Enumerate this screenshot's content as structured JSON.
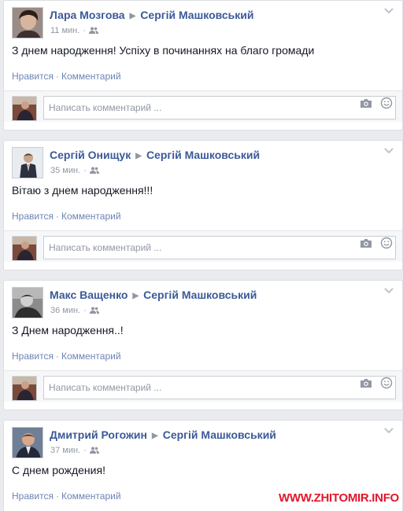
{
  "posts": [
    {
      "author": "Лара Мозгова",
      "target": "Сергій Машковський",
      "time": "11 мин.",
      "text": "З днем народження! Успіху в починаннях на благо громади",
      "like_label": "Нравится",
      "comment_label": "Комментарий",
      "comment_placeholder": "Написать комментарий ..."
    },
    {
      "author": "Сергій Онищук",
      "target": "Сергій Машковський",
      "time": "35 мин.",
      "text": "Вітаю з днем народження!!!",
      "like_label": "Нравится",
      "comment_label": "Комментарий",
      "comment_placeholder": "Написать комментарий ..."
    },
    {
      "author": "Макс Ващенко",
      "target": "Сергій Машковський",
      "time": "36 мин.",
      "text": "З Днем народження..!",
      "like_label": "Нравится",
      "comment_label": "Комментарий",
      "comment_placeholder": "Написать комментарий ..."
    },
    {
      "author": "Дмитрий Рогожин",
      "target": "Сергій Машковський",
      "time": "37 мин.",
      "text": "С днем рождения!",
      "like_label": "Нравится",
      "comment_label": "Комментарий"
    }
  ],
  "watermark": "WWW.ZHITOMIR.INFO",
  "icons": {
    "arrow": "triangle-right-icon",
    "audience": "friends-icon",
    "menu": "chevron-down-icon",
    "camera": "camera-icon",
    "emoji": "smiley-icon"
  },
  "colors": {
    "link": "#3b5998",
    "action": "#6d84b4",
    "muted": "#9197a3",
    "watermark": "#e0182c"
  }
}
